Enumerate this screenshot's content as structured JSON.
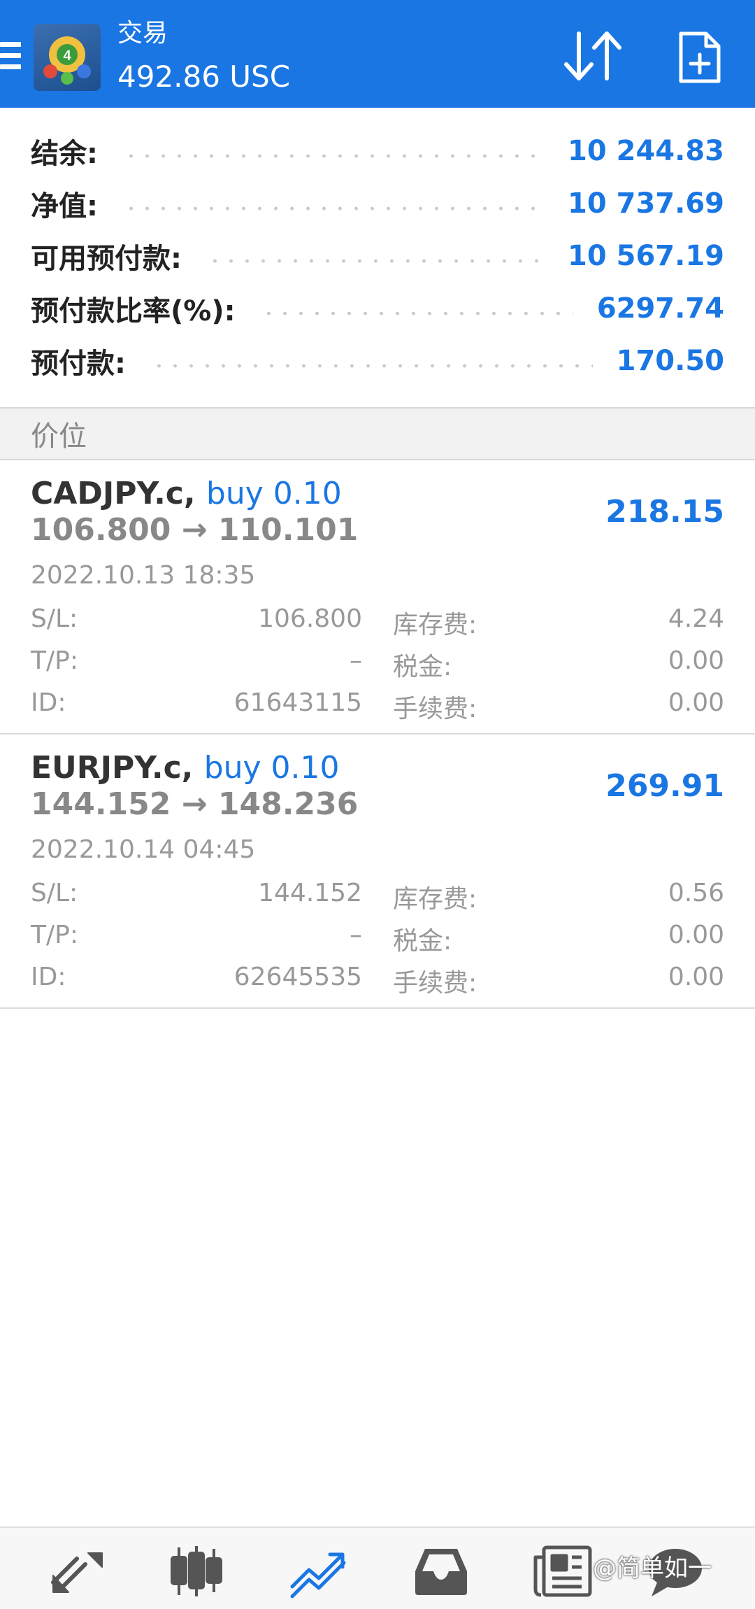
{
  "header": {
    "title": "交易",
    "balance_summary": "492.86 USC"
  },
  "account": {
    "rows": [
      {
        "label": "结余:",
        "value": "10 244.83"
      },
      {
        "label": "净值:",
        "value": "10 737.69"
      },
      {
        "label": "可用预付款:",
        "value": "10 567.19"
      },
      {
        "label": "预付款比率(%):",
        "value": "6297.74"
      },
      {
        "label": "预付款:",
        "value": "170.50"
      }
    ]
  },
  "section_title": "价位",
  "positions": [
    {
      "symbol": "CADJPY.c,",
      "side": "buy 0.10",
      "prices": "106.800 → 110.101",
      "profit": "218.15",
      "time": "2022.10.13 18:35",
      "sl_label": "S/L:",
      "sl": "106.800",
      "tp_label": "T/P:",
      "tp": "–",
      "id_label": "ID:",
      "id": "61643115",
      "swap_label": "库存费:",
      "swap": "4.24",
      "tax_label": "税金:",
      "tax": "0.00",
      "commission_label": "手续费:",
      "commission": "0.00"
    },
    {
      "symbol": "EURJPY.c,",
      "side": "buy 0.10",
      "prices": "144.152 → 148.236",
      "profit": "269.91",
      "time": "2022.10.14 04:45",
      "sl_label": "S/L:",
      "sl": "144.152",
      "tp_label": "T/P:",
      "tp": "–",
      "id_label": "ID:",
      "id": "62645535",
      "swap_label": "库存费:",
      "swap": "0.56",
      "tax_label": "税金:",
      "tax": "0.00",
      "commission_label": "手续费:",
      "commission": "0.00"
    }
  ],
  "nav": {
    "items": [
      "quotes-icon",
      "chart-icon",
      "trade-icon",
      "history-icon",
      "news-icon",
      "messages-icon"
    ],
    "active": "trade-icon"
  },
  "watermark": "@简单如一",
  "colors": {
    "accent": "#1a76e3",
    "header_bg": "#1a76e3",
    "muted_text": "#999999"
  }
}
